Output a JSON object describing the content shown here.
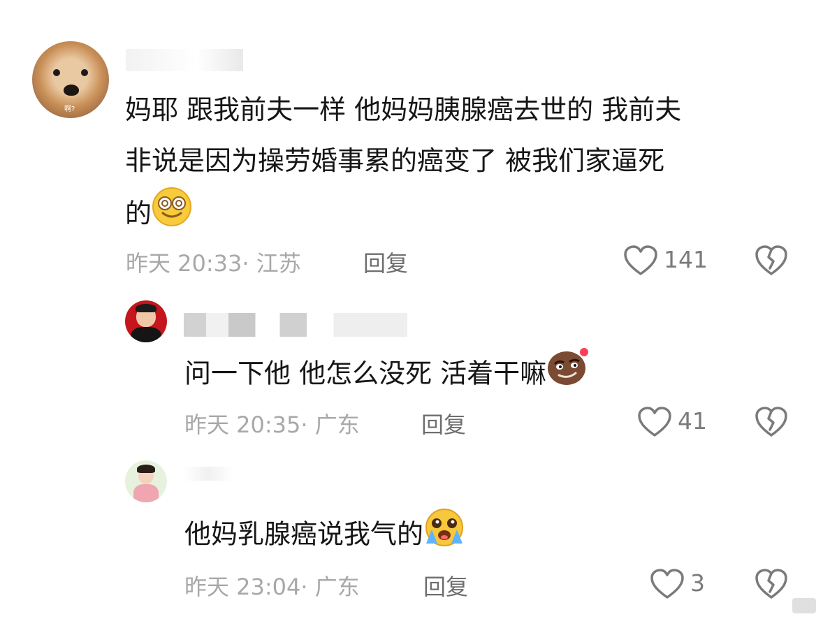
{
  "comments": [
    {
      "text_lines": [
        "妈耶  跟我前夫一样  他妈妈胰腺癌去世的  我前夫",
        "非说是因为操劳婚事累的癌变了   被我们家逼死",
        "的"
      ],
      "time": "昨天 20:33",
      "location": "江苏",
      "reply_label": "回复",
      "likes": "141",
      "avatar_tag": "啊?",
      "emoji": "dizzy-smile-emoji"
    },
    {
      "text": "问一下他 他怎么没死 活着干嘛",
      "time": "昨天 20:35",
      "location": "广东",
      "reply_label": "回复",
      "likes": "41",
      "emoji": "smirk-potato-emoji"
    },
    {
      "text": "他妈乳腺癌说我气的",
      "time": "昨天 23:04",
      "location": "广东",
      "reply_label": "回复",
      "likes": "3",
      "emoji": "crying-emoji"
    }
  ],
  "colors": {
    "text": "#161616",
    "meta": "#a8a8a8",
    "icon": "#7a7a7a"
  }
}
